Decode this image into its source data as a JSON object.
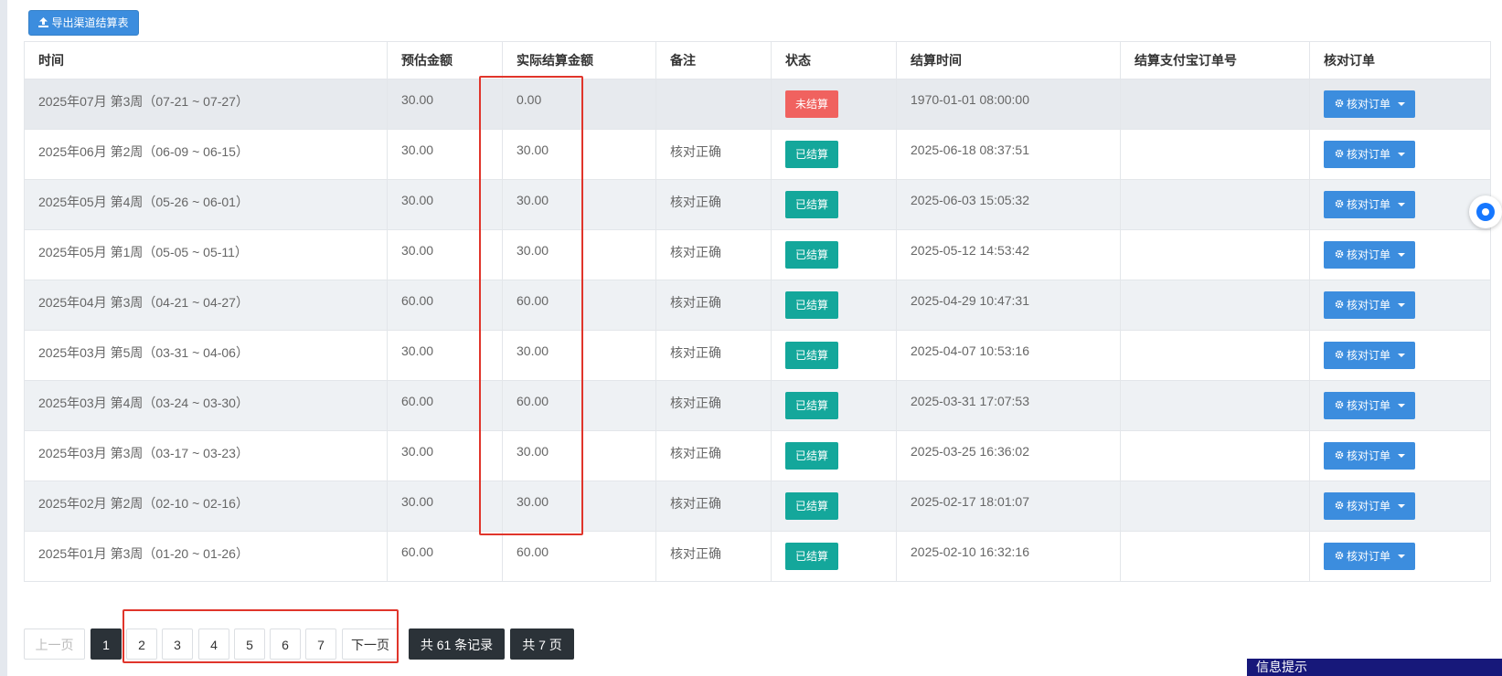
{
  "toolbar": {
    "export_label": "导出渠道结算表"
  },
  "table": {
    "headers": [
      "时间",
      "预估金额",
      "实际结算金额",
      "备注",
      "状态",
      "结算时间",
      "结算支付宝订单号",
      "核对订单"
    ],
    "rows": [
      {
        "period": "2025年07月 第3周（07-21 ~ 07-27）",
        "estimated": "30.00",
        "actual": "0.00",
        "note": "",
        "status": "未结算",
        "status_type": "unpaid",
        "settle_time": "1970-01-01 08:00:00",
        "alipay_order": "",
        "action": "核对订单"
      },
      {
        "period": "2025年06月 第2周（06-09 ~ 06-15）",
        "estimated": "30.00",
        "actual": "30.00",
        "note": "核对正确",
        "status": "已结算",
        "status_type": "paid",
        "settle_time": "2025-06-18 08:37:51",
        "alipay_order": "",
        "action": "核对订单"
      },
      {
        "period": "2025年05月 第4周（05-26 ~ 06-01）",
        "estimated": "30.00",
        "actual": "30.00",
        "note": "核对正确",
        "status": "已结算",
        "status_type": "paid",
        "settle_time": "2025-06-03 15:05:32",
        "alipay_order": "",
        "action": "核对订单"
      },
      {
        "period": "2025年05月 第1周（05-05 ~ 05-11）",
        "estimated": "30.00",
        "actual": "30.00",
        "note": "核对正确",
        "status": "已结算",
        "status_type": "paid",
        "settle_time": "2025-05-12 14:53:42",
        "alipay_order": "",
        "action": "核对订单"
      },
      {
        "period": "2025年04月 第3周（04-21 ~ 04-27）",
        "estimated": "60.00",
        "actual": "60.00",
        "note": "核对正确",
        "status": "已结算",
        "status_type": "paid",
        "settle_time": "2025-04-29 10:47:31",
        "alipay_order": "",
        "action": "核对订单"
      },
      {
        "period": "2025年03月 第5周（03-31 ~ 04-06）",
        "estimated": "30.00",
        "actual": "30.00",
        "note": "核对正确",
        "status": "已结算",
        "status_type": "paid",
        "settle_time": "2025-04-07 10:53:16",
        "alipay_order": "",
        "action": "核对订单"
      },
      {
        "period": "2025年03月 第4周（03-24 ~ 03-30）",
        "estimated": "60.00",
        "actual": "60.00",
        "note": "核对正确",
        "status": "已结算",
        "status_type": "paid",
        "settle_time": "2025-03-31 17:07:53",
        "alipay_order": "",
        "action": "核对订单"
      },
      {
        "period": "2025年03月 第3周（03-17 ~ 03-23）",
        "estimated": "30.00",
        "actual": "30.00",
        "note": "核对正确",
        "status": "已结算",
        "status_type": "paid",
        "settle_time": "2025-03-25 16:36:02",
        "alipay_order": "",
        "action": "核对订单"
      },
      {
        "period": "2025年02月 第2周（02-10 ~ 02-16）",
        "estimated": "30.00",
        "actual": "30.00",
        "note": "核对正确",
        "status": "已结算",
        "status_type": "paid",
        "settle_time": "2025-02-17 18:01:07",
        "alipay_order": "",
        "action": "核对订单"
      },
      {
        "period": "2025年01月 第3周（01-20 ~ 01-26）",
        "estimated": "60.00",
        "actual": "60.00",
        "note": "核对正确",
        "status": "已结算",
        "status_type": "paid",
        "settle_time": "2025-02-10 16:32:16",
        "alipay_order": "",
        "action": "核对订单"
      }
    ]
  },
  "pagination": {
    "prev_label": "上一页",
    "pages": [
      "1",
      "2",
      "3",
      "4",
      "5",
      "6",
      "7"
    ],
    "current_page": "1",
    "next_label": "下一页",
    "total_records": "共 61 条记录",
    "total_pages": "共 7 页"
  },
  "info_panel": {
    "title": "信息提示"
  },
  "colors": {
    "primary": "#3c8dde",
    "paid": "#14a79b",
    "unpaid": "#f0625f",
    "pager_active": "#2b3238",
    "highlight": "#e0352b",
    "info_panel": "#17187a"
  }
}
